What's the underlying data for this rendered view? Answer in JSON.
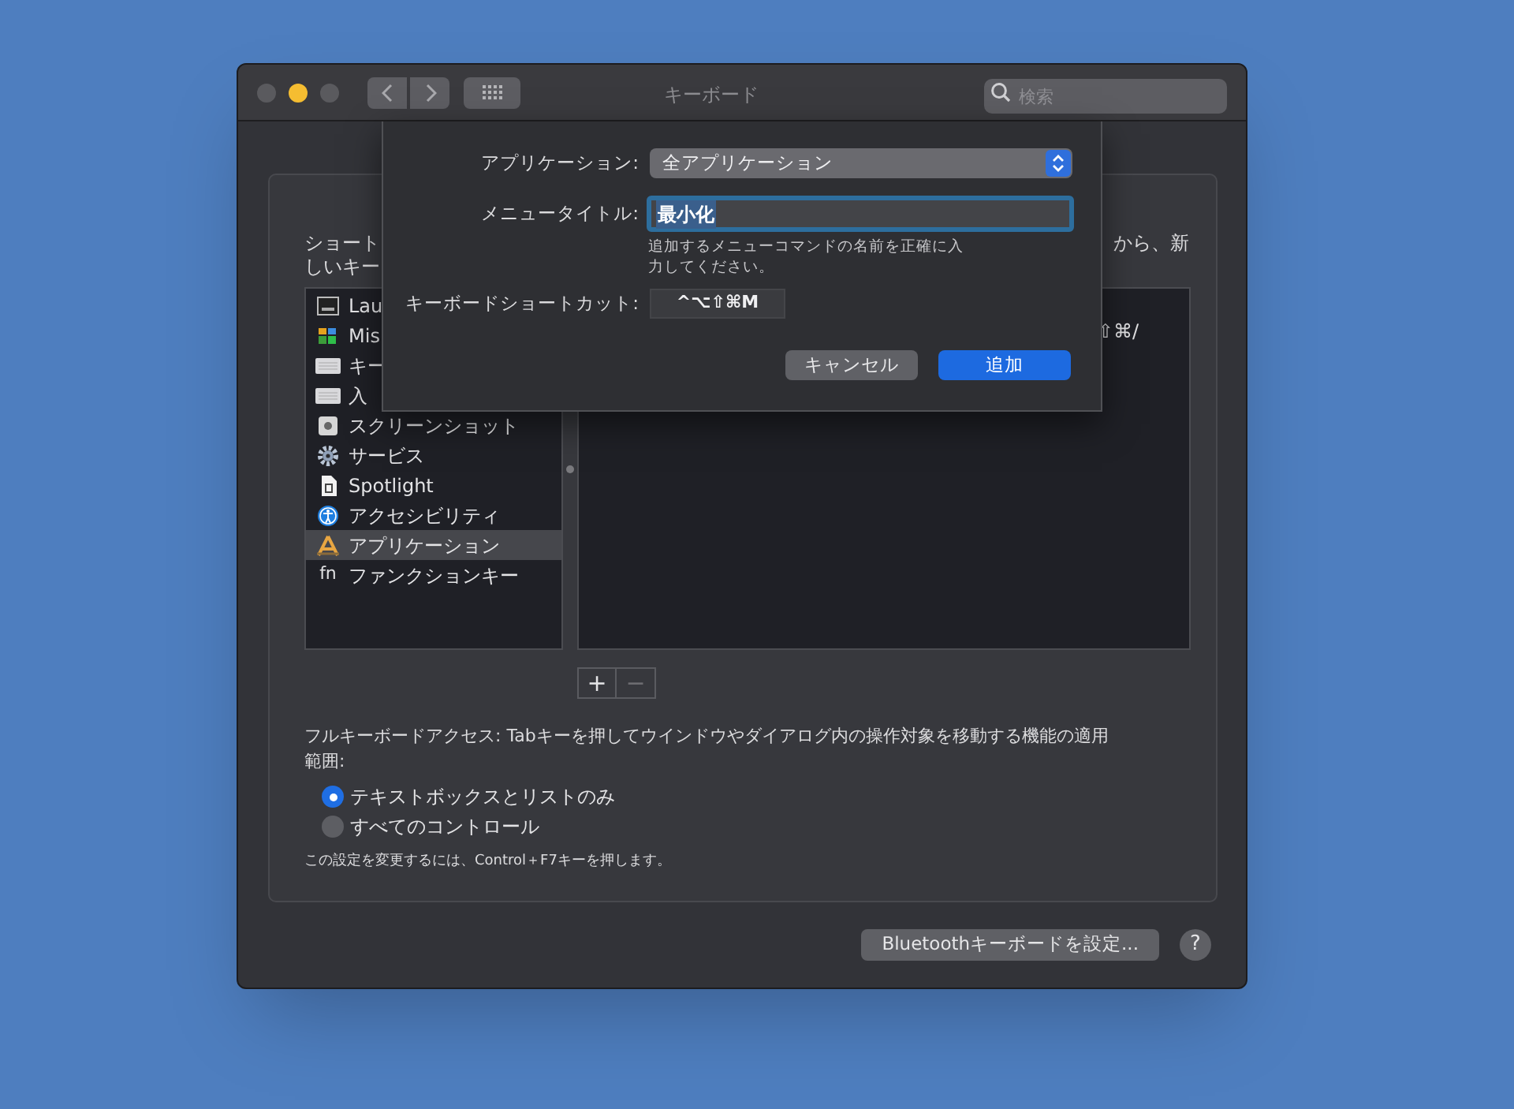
{
  "window": {
    "title": "キーボード",
    "search_placeholder": "検索"
  },
  "sheet": {
    "application_label": "アプリケーション:",
    "application_value": "全アプリケーション",
    "menu_title_label": "メニュータイトル:",
    "menu_title_value": "最小化",
    "hint": "追加するメニューコマンドの名前を正確に入力してください。",
    "shortcut_label": "キーボードショートカット:",
    "shortcut_value": "^⌥⇧⌘M",
    "buttons": [
      {
        "label": "キャンセル",
        "kind": "secondary"
      },
      {
        "label": "追加",
        "kind": "primary"
      }
    ]
  },
  "intro": {
    "left_lines": [
      "ショート",
      "しいキー"
    ],
    "right_line": "から、新"
  },
  "categories": [
    {
      "label": "Lau",
      "kind": "launchpad",
      "selected": false
    },
    {
      "label": "Mis",
      "kind": "mission",
      "selected": false
    },
    {
      "label": "キー",
      "kind": "keyboard",
      "selected": false
    },
    {
      "label": "入",
      "kind": "keyboard",
      "selected": false
    },
    {
      "label": "スクリーンショット",
      "kind": "screenshot",
      "selected": false
    },
    {
      "label": "サービス",
      "kind": "gear",
      "selected": false
    },
    {
      "label": "Spotlight",
      "kind": "spotlight",
      "selected": false
    },
    {
      "label": "アクセシビリティ",
      "kind": "accessibility",
      "selected": false
    },
    {
      "label": "アプリケーション",
      "kind": "app",
      "selected": true
    },
    {
      "label": "ファンクションキー",
      "kind": "fn",
      "icon_text": "fn",
      "selected": false
    }
  ],
  "shortcut_fragment": "⇧⌘/",
  "list_buttons": [
    "+",
    "−"
  ],
  "full_keyboard_access": {
    "description": "フルキーボードアクセス: Tabキーを押してウインドウやダイアログ内の操作対象を移動する機能の適用範囲:",
    "options": [
      {
        "label": "テキストボックスとリストのみ",
        "selected": true
      },
      {
        "label": "すべてのコントロール",
        "selected": false
      }
    ],
    "note": "この設定を変更するには、Control＋F7キーを押します。"
  },
  "bluetooth_button": "Bluetoothキーボードを設定...",
  "help_button": "?"
}
